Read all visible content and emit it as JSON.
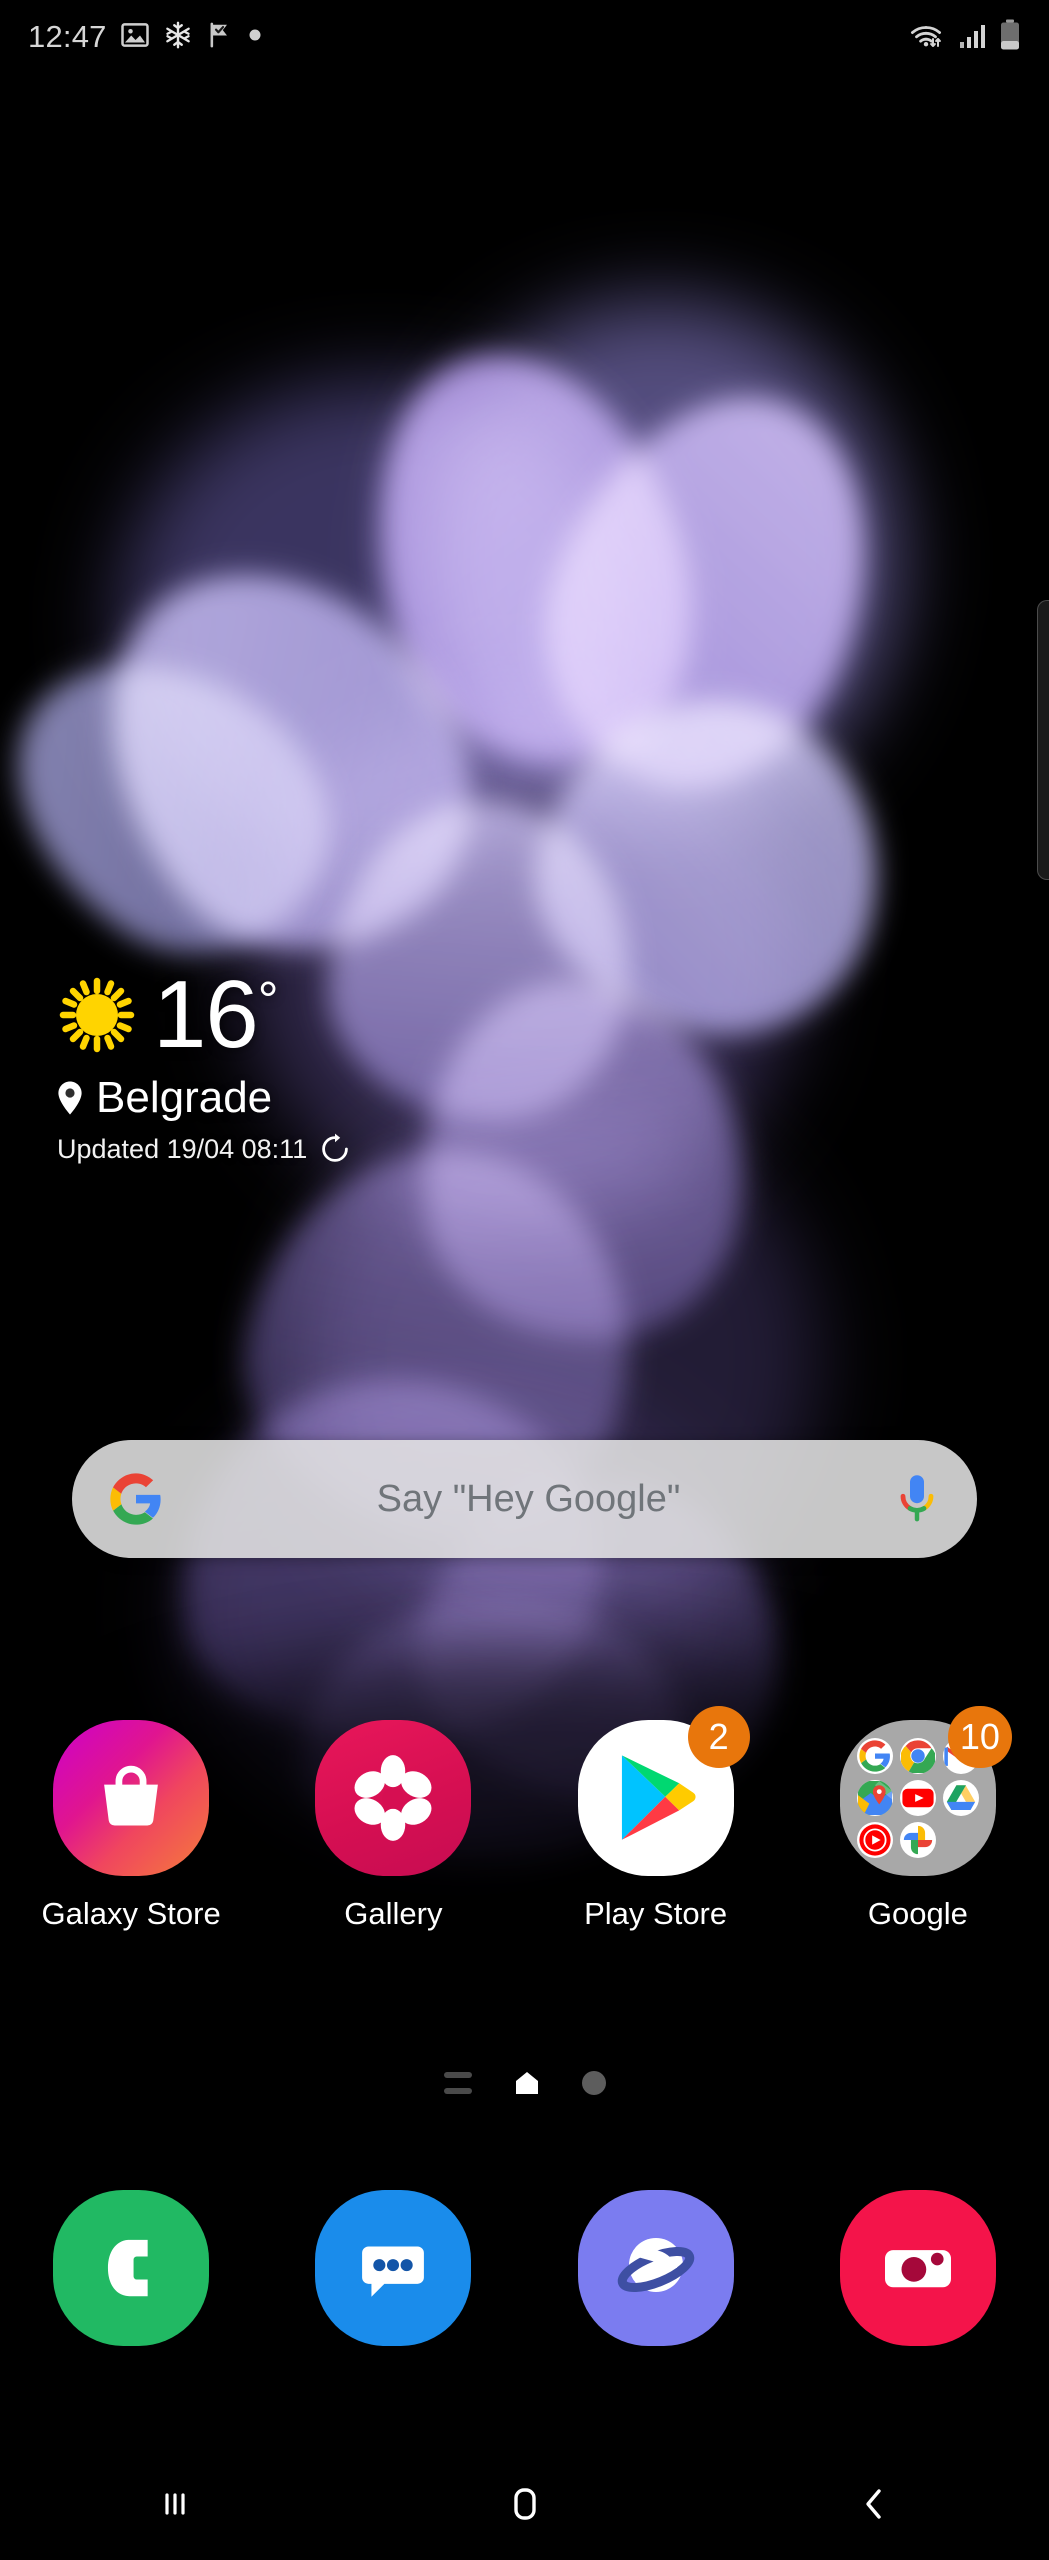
{
  "status_bar": {
    "clock": "12:47",
    "left_icons": [
      "image-icon",
      "snowflake-icon",
      "flag-check-icon",
      "dot-icon"
    ],
    "right_icons": [
      "wifi-data-icon",
      "cellular-signal-icon",
      "battery-icon"
    ]
  },
  "weather": {
    "condition_icon": "sun-icon",
    "temperature": "16",
    "degree": "°",
    "location_icon": "location-pin-icon",
    "city": "Belgrade",
    "updated": "Updated 19/04 08:11",
    "refresh_icon": "refresh-icon"
  },
  "search": {
    "logo": "google-g-icon",
    "placeholder": "Say \"Hey Google\"",
    "mic_icon": "microphone-icon"
  },
  "apps": [
    {
      "label": "Galaxy Store",
      "icon": "galaxy-store-icon",
      "badge": null
    },
    {
      "label": "Gallery",
      "icon": "gallery-icon",
      "badge": null
    },
    {
      "label": "Play Store",
      "icon": "play-store-icon",
      "badge": "2"
    },
    {
      "label": "Google",
      "icon": "google-folder-icon",
      "badge": "10",
      "folder_contents": [
        "google-search-icon",
        "chrome-icon",
        "gmail-icon",
        "maps-icon",
        "youtube-icon",
        "drive-icon",
        "youtube-music-icon",
        "photos-icon"
      ]
    }
  ],
  "page_indicator": {
    "pages": [
      "apps-page-icon",
      "home-page-icon",
      "page-dot"
    ],
    "current": 1
  },
  "dock": [
    {
      "label": "Phone",
      "icon": "phone-icon"
    },
    {
      "label": "Messages",
      "icon": "messages-icon"
    },
    {
      "label": "Internet",
      "icon": "samsung-internet-icon"
    },
    {
      "label": "Camera",
      "icon": "camera-icon"
    }
  ],
  "nav_bar": [
    {
      "label": "Recents",
      "icon": "recents-icon"
    },
    {
      "label": "Home",
      "icon": "home-icon"
    },
    {
      "label": "Back",
      "icon": "back-icon"
    }
  ],
  "edge_panel": {
    "handle": "edge-panel-handle"
  },
  "colors": {
    "background": "#000000",
    "badge": "#e8760c",
    "search_bar": "#e2e2e2",
    "search_text": "#70757a",
    "phone": "#21b963",
    "messages": "#1a8ceb",
    "internet": "#7b7cf0",
    "camera": "#f4144a",
    "gallery": "#e3134e",
    "folder": "#a8a8a8"
  }
}
